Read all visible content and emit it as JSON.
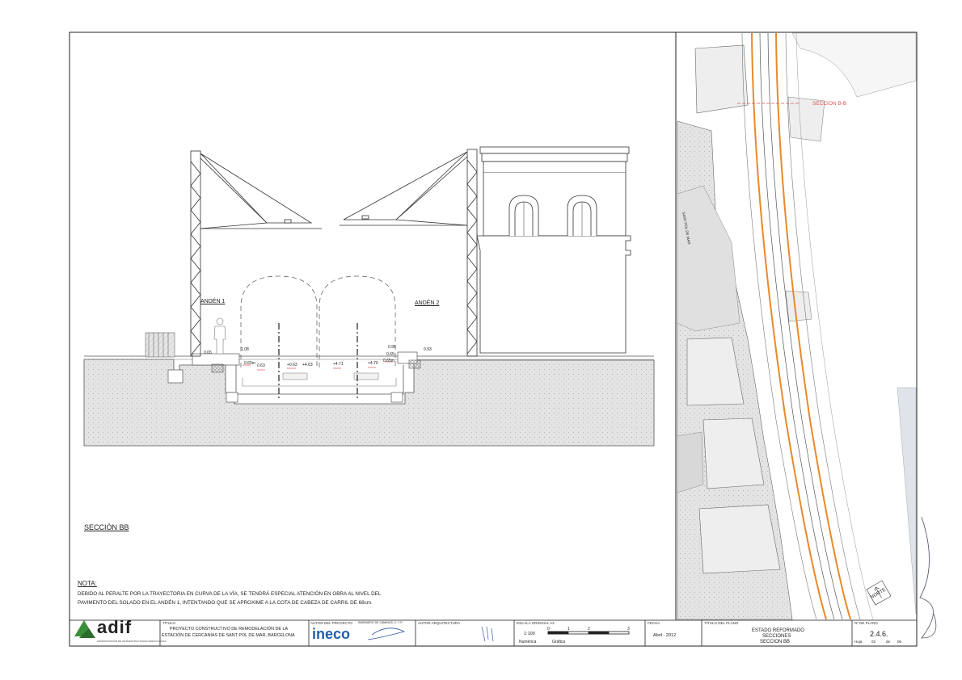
{
  "drawing": {
    "section_title": "SECCIÓN BB",
    "platform_1": "ANDÉN 1",
    "platform_2": "ANDÉN 2",
    "dim_labels": [
      "0.65",
      "1.08",
      "0.65m",
      "0.63",
      "+0.63",
      "+4.63",
      "+4.71",
      "+4.70",
      "0.65m",
      "0.65",
      "0.95",
      "0.93"
    ]
  },
  "note": {
    "heading": "NOTA:",
    "line1": "DEBIDO AL PERALTE POR LA TRAYECTORIA EN CURVA DE LA VÍA, SE TENDRÁ ESPECIAL ATENCIÓN EN OBRA AL NIVEL DEL",
    "line2": "PAVIMENTO DEL SOLADO EN EL ANDÉN 1, INTENTANDO QUE SE APROXIME A LA COTA DE CABEZA DE CARRIL DE 68cm."
  },
  "map": {
    "section_label": "SECCION B-B",
    "street_label": "SANT POL DE MAR",
    "north_label": "NORTE"
  },
  "title_block": {
    "logo_text": "adif",
    "logo_sub": "ADMINISTRADOR DE INFRAESTRUCTURAS FERROVIARIAS",
    "titulo_head": "TÍTULO",
    "titulo_line1": "PROYECTO CONSTRUCTIVO DE REMODELACIÓN DE LA",
    "titulo_line2": "ESTACIÓN DE CERCANÍAS DE SANT POL DE MAR, BARCELONA",
    "autor_head": "AUTOR DEL PROYECTO",
    "autor_sub": "INGENIERO DE CAMINOS, C. Y P.",
    "company": "ineco",
    "arq_head": "AUTOR ARQUITECTURA",
    "escala_head": "ESCALA ORIGINAL A3",
    "escala_value": "1:100",
    "numerica": "Numérica",
    "grafica": "Gráfica",
    "scale_ticks": [
      "0",
      "1",
      "2",
      "3"
    ],
    "fecha_head": "FECHA",
    "fecha_value": "Abril - 2012",
    "titulo_plano_head": "TÍTULO DEL PLANO",
    "plano_line1": "ESTADO REFORMADO",
    "plano_line2": "SECCIONES",
    "plano_line3": "SECCION BB",
    "num_head": "Nº DE PLANO",
    "num_value": "2.4.6.",
    "hoja": "Hoja",
    "hoja_num": "02",
    "de": "de",
    "hoja_total": "05"
  },
  "colors": {
    "track_accent": "#e8892b",
    "section_marker": "#d9534f",
    "logo_green": "#3a8f3a",
    "company_blue": "#1f5fa8",
    "hatch": "#dcdcdc"
  }
}
